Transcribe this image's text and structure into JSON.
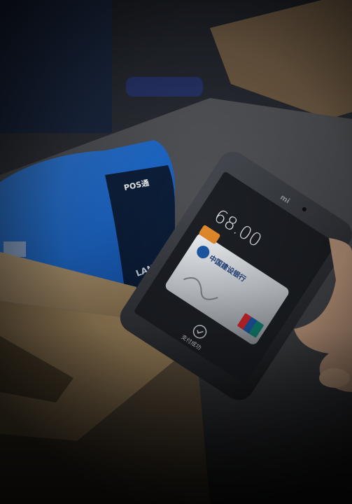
{
  "phone": {
    "brand_logo": "mi",
    "amount": "68.00",
    "status_text": "支付成功",
    "card_bank_name": "中国建设银行",
    "card_network": "UnionPay"
  },
  "pos_terminal": {
    "brand_label": "POS通",
    "side_label": "LAND"
  },
  "icons": {
    "check": "check-circle-icon"
  },
  "colors": {
    "pos_blue": "#1f6fd6",
    "phone_body": "#2b2e33",
    "screen_bg": "#1c1f24",
    "wood": "#b79a72",
    "card_silver": "#d9dde2",
    "unionpay_red": "#d0262b",
    "unionpay_blue": "#1e56a0"
  }
}
